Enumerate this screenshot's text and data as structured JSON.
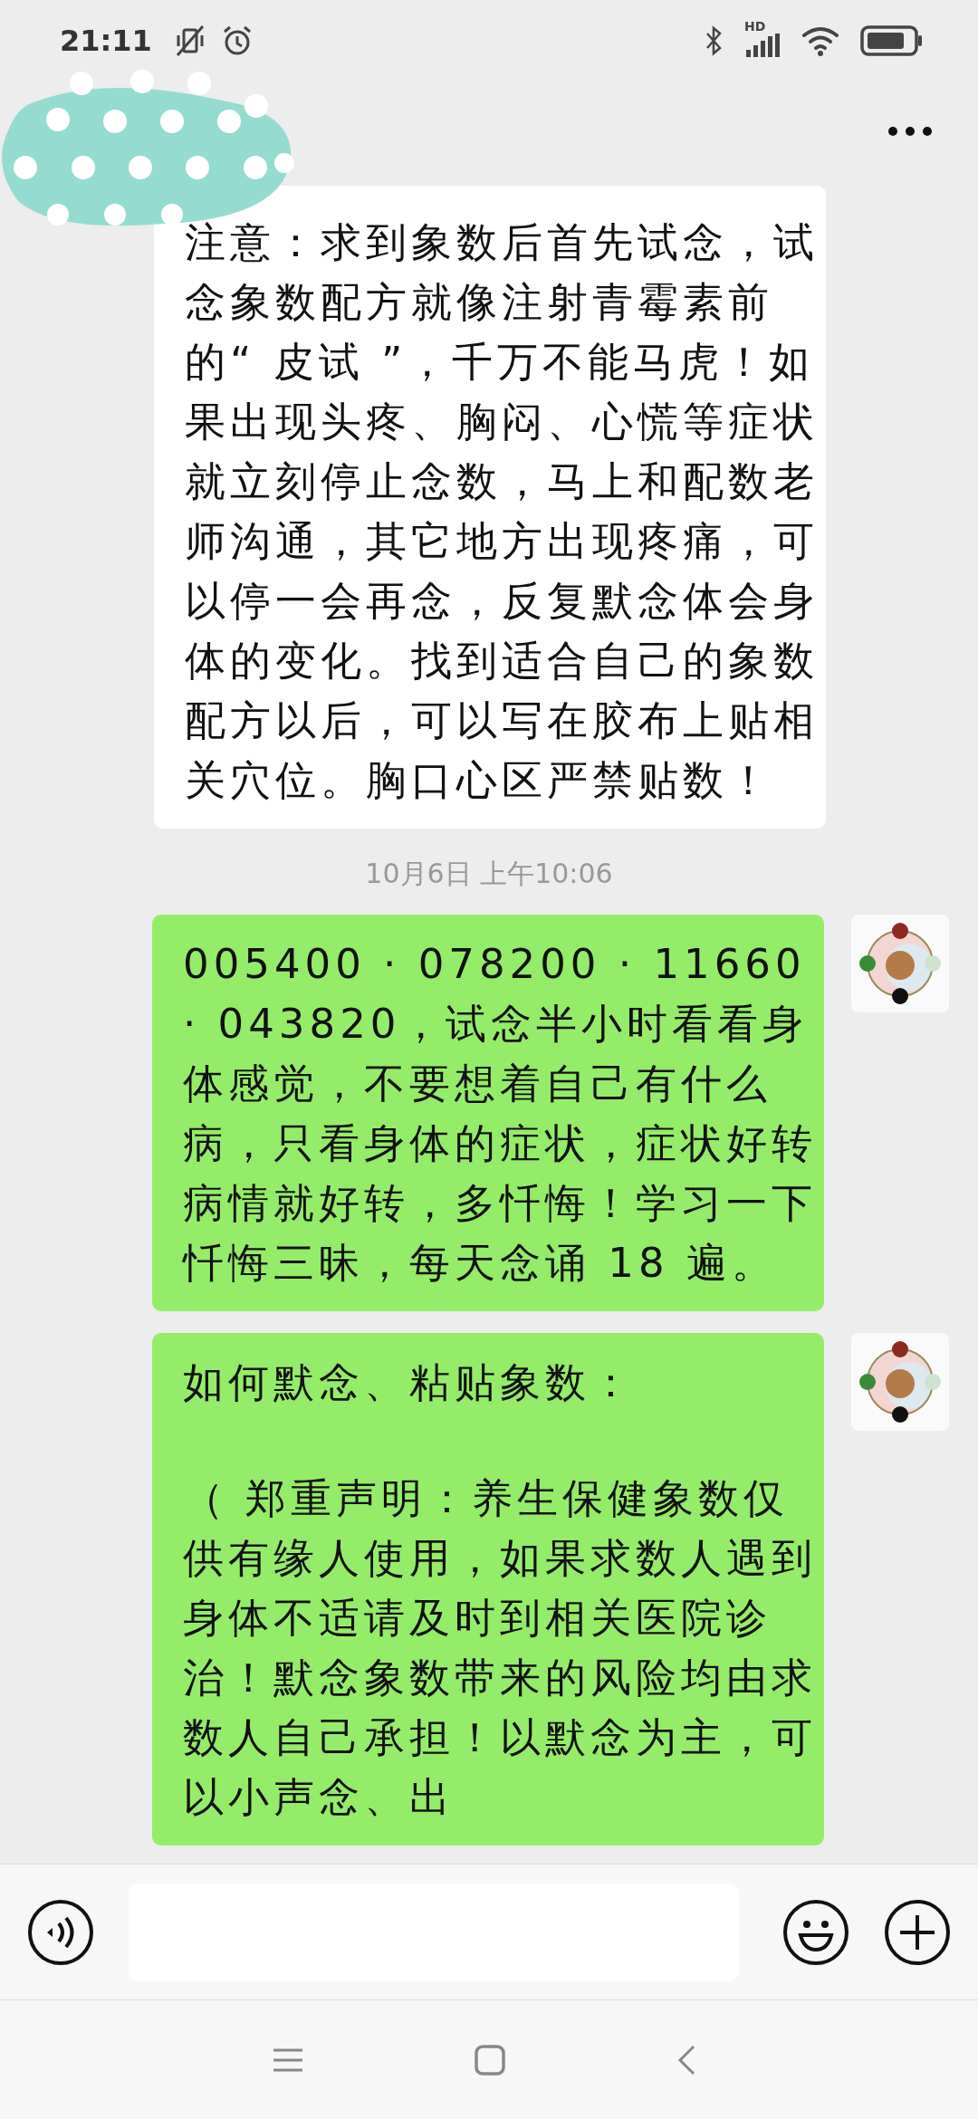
{
  "status_bar": {
    "time": "21:11",
    "network_label": "HD"
  },
  "messages": [
    {
      "kind": "received",
      "paragraphs": [
        "注意：求到象数后首先试念，试念象数配方就像注射青霉素前的“ 皮试 ”，千万不能马虎！如果出现头疼、胸闷、心慌等症状就立刻停止念数，马上和配数老师沟通，其它地方出现疼痛，可以停一会再念，反复默念体会身体的变化。找到适合自己的象数配方以后，可以写在胶布上贴相关穴位。胸口心区严禁贴数！"
      ]
    },
    {
      "kind": "timestamp",
      "text": "10月6日 上午10:06"
    },
    {
      "kind": "sent",
      "paragraphs": [
        "005400 · 078200 · 11660 · 043820，试念半小时看看身体感觉，不要想着自己有什么病，只看身体的症状，症状好转病情就好转，多忏悔！学习一下忏悔三昧，每天念诵 18 遍。"
      ]
    },
    {
      "kind": "sent",
      "paragraphs": [
        "如何默念、粘贴象数：",
        "（ 郑重声明：养生保健象数仅供有缘人使用，如果求数人遇到身体不适请及时到相关医院诊治！默念象数带来的风险均由求数人自己承担！以默念为主，可以小声念、出"
      ]
    }
  ]
}
